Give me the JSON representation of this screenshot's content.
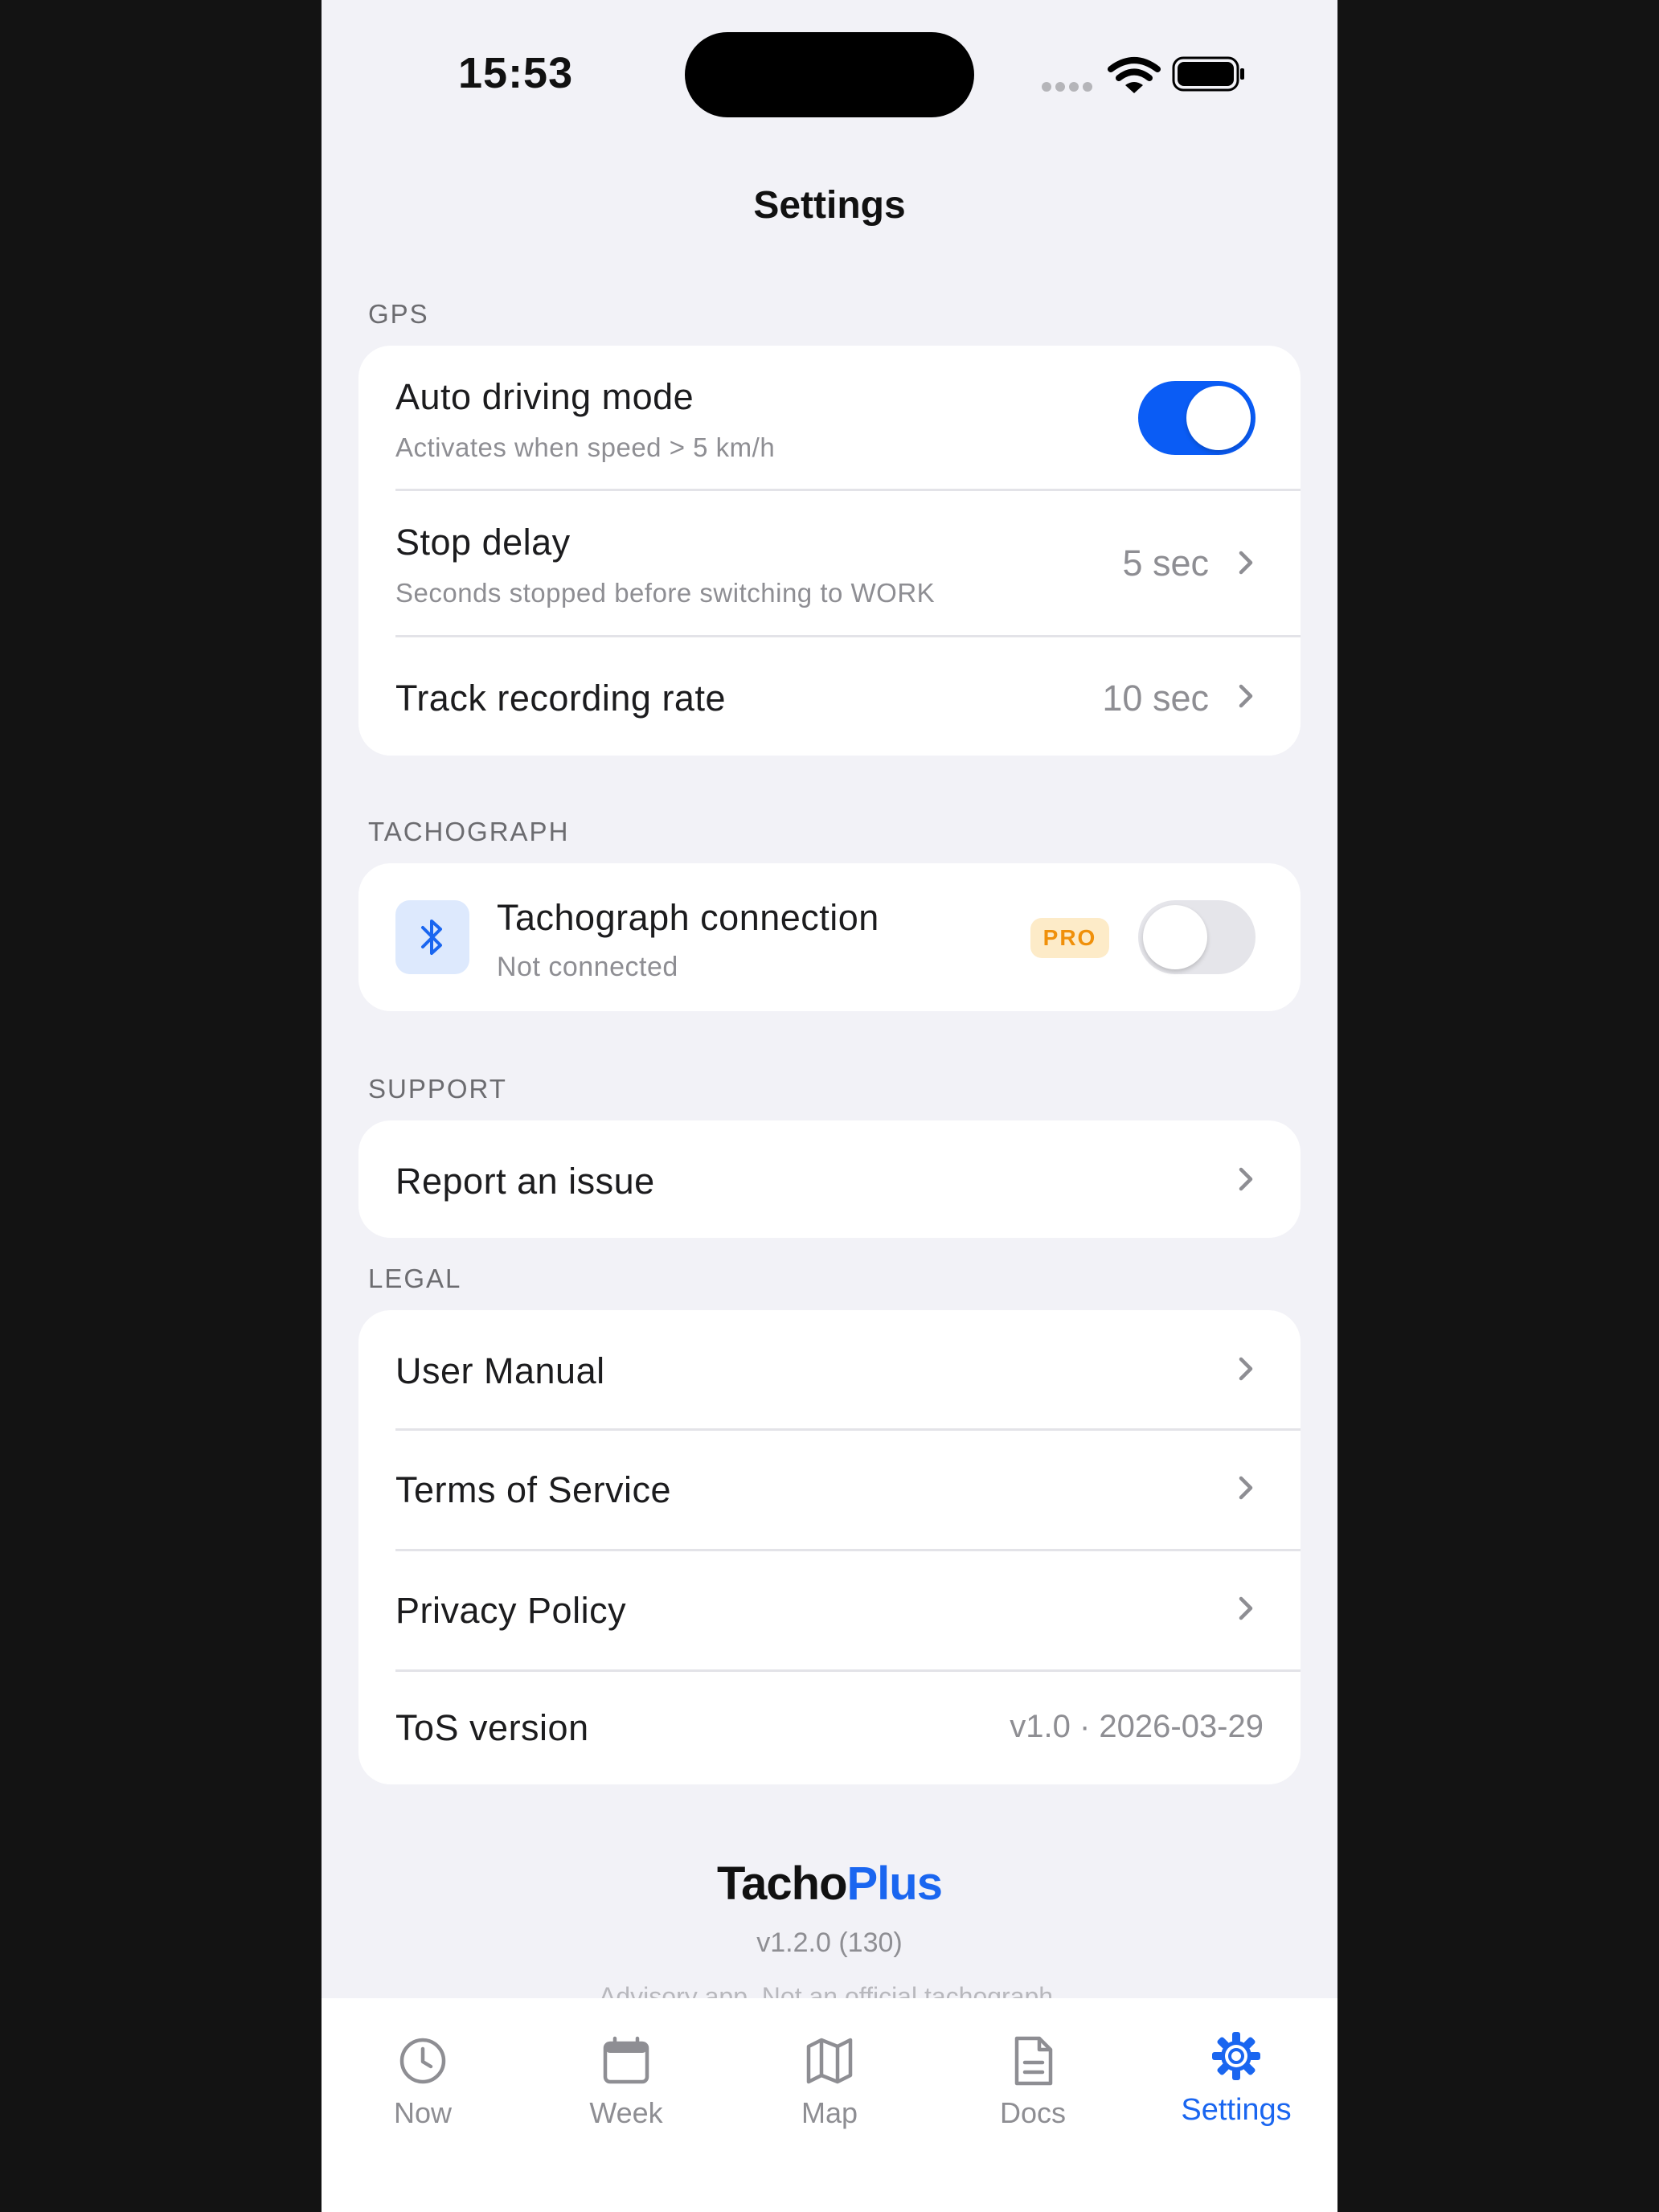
{
  "status_bar": {
    "time": "15:53"
  },
  "nav": {
    "title": "Settings"
  },
  "gps": {
    "header": "GPS",
    "auto_driving": {
      "title": "Auto driving mode",
      "subtitle": "Activates when speed > 5 km/h",
      "enabled": true
    },
    "stop_delay": {
      "title": "Stop delay",
      "subtitle": "Seconds stopped before switching to WORK",
      "value": "5 sec"
    },
    "track_rate": {
      "title": "Track recording rate",
      "value": "10 sec"
    }
  },
  "tachograph": {
    "header": "TACHOGRAPH",
    "connection": {
      "title": "Tachograph connection",
      "subtitle": "Not connected",
      "badge": "PRO",
      "enabled": false
    }
  },
  "support": {
    "header": "SUPPORT",
    "report": {
      "title": "Report an issue"
    }
  },
  "legal": {
    "header": "LEGAL",
    "user_manual": {
      "title": "User Manual"
    },
    "terms": {
      "title": "Terms of Service"
    },
    "privacy": {
      "title": "Privacy Policy"
    },
    "tos_version": {
      "title": "ToS version",
      "value": "v1.0 · 2026-03-29"
    }
  },
  "footer": {
    "brand_part1": "Tacho",
    "brand_part2": "Plus",
    "version": "v1.2.0 (130)",
    "disclaimer": "Advisory app. Not an official tachograph."
  },
  "tabs": [
    {
      "label": "Now",
      "icon": "clock-icon"
    },
    {
      "label": "Week",
      "icon": "calendar-icon"
    },
    {
      "label": "Map",
      "icon": "map-icon"
    },
    {
      "label": "Docs",
      "icon": "document-icon"
    },
    {
      "label": "Settings",
      "icon": "gear-icon",
      "active": true
    }
  ],
  "colors": {
    "accent": "#0a5cf5",
    "background": "#f2f2f7",
    "pro_badge_bg": "#fdebc8",
    "pro_badge_text": "#f0900a"
  }
}
